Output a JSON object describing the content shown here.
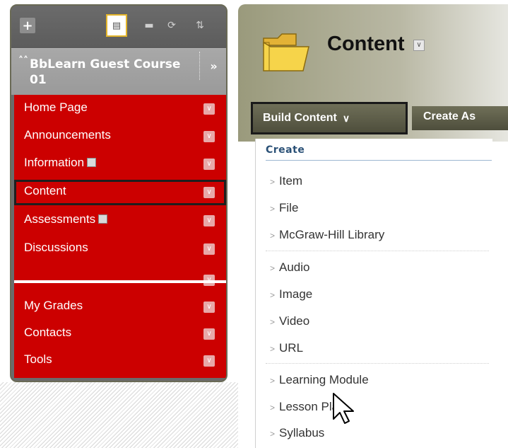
{
  "course_menu": {
    "course_title": "BbLearn Guest Course 01",
    "items": [
      {
        "label": "Home Page",
        "badge": false
      },
      {
        "label": "Announcements",
        "badge": false
      },
      {
        "label": "Information",
        "badge": true
      },
      {
        "label": "Content",
        "badge": false,
        "selected": true
      },
      {
        "label": "Assessments",
        "badge": true
      },
      {
        "label": "Discussions",
        "badge": false
      },
      {
        "label": "My Grades",
        "badge": false
      },
      {
        "label": "Contacts",
        "badge": false
      },
      {
        "label": "Tools",
        "badge": false
      }
    ]
  },
  "content": {
    "page_title": "Content",
    "build_content_label": "Build Content",
    "create_assessment_label": "Create As",
    "dropdown": {
      "heading": "Create",
      "items": [
        "Item",
        "File",
        "McGraw-Hill Library",
        "Audio",
        "Image",
        "Video",
        "URL",
        "Learning Module",
        "Lesson Plan",
        "Syllabus"
      ]
    }
  },
  "colors": {
    "menu_red": "#cc0000",
    "header_olive": "#9a9a7c",
    "heading_blue": "#2b5177"
  }
}
